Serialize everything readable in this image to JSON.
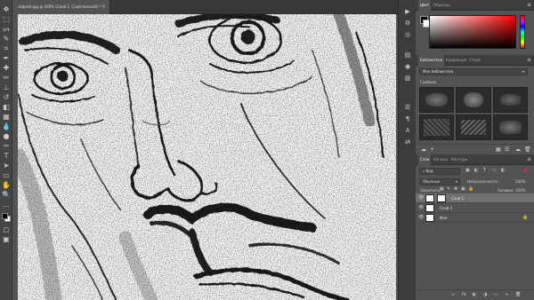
{
  "document": {
    "tab_title": "зафлеб.jpg @ 200% (Слой 1, Слой-маска/8) *",
    "close_glyph": "×"
  },
  "toolbar": {
    "tools": [
      {
        "name": "move-tool",
        "glyph": "✥"
      },
      {
        "name": "marquee-tool",
        "glyph": "⬚"
      },
      {
        "name": "lasso-tool",
        "glyph": "ᔕ"
      },
      {
        "name": "quick-select-tool",
        "glyph": "✎"
      },
      {
        "name": "crop-tool",
        "glyph": "⌗"
      },
      {
        "name": "eyedropper-tool",
        "glyph": "✒"
      },
      {
        "name": "healing-brush-tool",
        "glyph": "✚"
      },
      {
        "name": "brush-tool",
        "glyph": "✏"
      },
      {
        "name": "clone-stamp-tool",
        "glyph": "⊥"
      },
      {
        "name": "history-brush-tool",
        "glyph": "↺"
      },
      {
        "name": "eraser-tool",
        "glyph": "◧"
      },
      {
        "name": "gradient-tool",
        "glyph": "▦"
      },
      {
        "name": "blur-tool",
        "glyph": "💧"
      },
      {
        "name": "dodge-tool",
        "glyph": "●"
      },
      {
        "name": "pen-tool",
        "glyph": "✑"
      },
      {
        "name": "type-tool",
        "glyph": "T"
      },
      {
        "name": "path-select-tool",
        "glyph": "➤"
      },
      {
        "name": "shape-tool",
        "glyph": "▭"
      },
      {
        "name": "hand-tool",
        "glyph": "✋"
      },
      {
        "name": "zoom-tool",
        "glyph": "🔍"
      },
      {
        "name": "more-tools",
        "glyph": "…"
      }
    ],
    "foreground_color": "#000000",
    "background_color": "#ffffff",
    "quick_mask_glyph": "◻",
    "screen_mode_glyph": "▣"
  },
  "right_strip": {
    "icons": [
      "▶",
      "⚙",
      "◎",
      "▤",
      "◉",
      "▥",
      "☰",
      "¶",
      "A",
      "⇄"
    ]
  },
  "color_panel": {
    "tabs": [
      "Цвет",
      "Образцы"
    ],
    "active_tab": 0,
    "foreground": "#000000",
    "background": "#ffffff",
    "hue_color": "#ff0000"
  },
  "libraries_panel": {
    "tabs": [
      "Библиотеки",
      "Коррекция",
      "Стили"
    ],
    "active_tab": 0,
    "library_select": "Моя библиотека",
    "section_label": "Графика"
  },
  "layers_panel": {
    "tabs": [
      "Слои",
      "Каналы",
      "Контуры"
    ],
    "active_tab": 0,
    "filter_label": "Вид",
    "blend_mode": "Обычные",
    "opacity_label": "Непрозрачность:",
    "opacity_value": "100%",
    "lock_label": "Закрепить:",
    "fill_label": "Заливка:",
    "fill_value": "100%",
    "layers": [
      {
        "name": "Слой 1",
        "selected": true,
        "visible": true,
        "has_mask": true
      },
      {
        "name": "Слой 2",
        "selected": false,
        "visible": true,
        "has_mask": false
      },
      {
        "name": "Фон",
        "selected": false,
        "visible": true,
        "has_mask": false,
        "locked": true
      }
    ],
    "bottom_icons": [
      "∞",
      "fx",
      "◐",
      "◑",
      "▭",
      "+",
      "🗑"
    ]
  },
  "colors": {
    "app_bg": "#535353",
    "toolbar_bg": "#444444",
    "panel_tab_bg": "#3e3e3e",
    "selected_layer": "#707070"
  }
}
